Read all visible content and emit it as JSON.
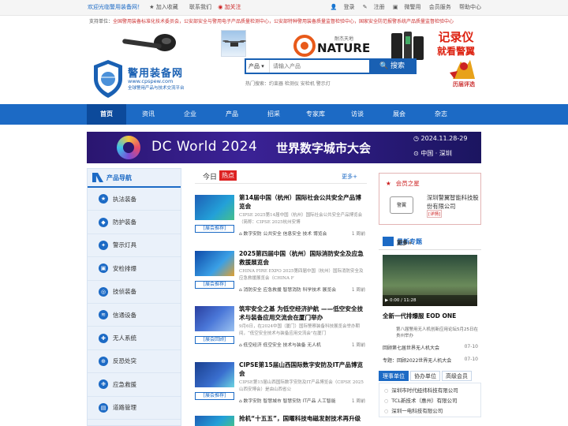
{
  "topbar": {
    "welcome": "欢迎光临警用装备网！",
    "add_favorite": "加入收藏",
    "contact": "联系我们",
    "follow": "加关注",
    "login": "登录",
    "register": "注册",
    "weibo": "微警用",
    "member_service": "会员服务",
    "help": "帮助中心"
  },
  "sponsor": {
    "label": "支持单位：",
    "text": "全国警用装备标准化技术委员会，公安部安全与警用电子产品质量检测中心，公安部特种警用装备质量监督检验中心，国家安全防范报警系统产品质量监督检验中心"
  },
  "ads": {
    "nature_brand": "NATURE",
    "nature_sub": "耐杰天地",
    "recorder_line1": "记录仪",
    "recorder_line2": "就看警翼"
  },
  "logo": {
    "title": "警用装备网",
    "url": "www.cpspew.com",
    "slogan": "全球警用产品与技术交流平台"
  },
  "search": {
    "category": "产品",
    "placeholder": "请输入产品",
    "button": "搜索",
    "hot_keywords": "热门搜索：约束器 检测仪 安检机 警示灯"
  },
  "award_label": "历届评选",
  "nav": [
    "首页",
    "资讯",
    "企业",
    "产品",
    "招采",
    "专家库",
    "访谈",
    "展会",
    "杂志"
  ],
  "banner": {
    "title_en": "DC World",
    "year": "2024",
    "title_cn": "世界数字城市大会",
    "date": "2024.11.28-29",
    "location": "中国 · 深圳"
  },
  "sidebar": {
    "title": "产品导航",
    "items": [
      "执法装备",
      "防护装备",
      "警示灯具",
      "安检排爆",
      "技侦装备",
      "信通设备",
      "无人系统",
      "反恐处突",
      "应急救援",
      "道路管理"
    ]
  },
  "main": {
    "today": "今日",
    "hot": "热点",
    "more": "更多+",
    "news": [
      {
        "title": "第14届中国（杭州）国际社会公共安全产品博览会",
        "desc": "CIPSE 2025第14届中国（杭州）国际社会公共安全产品博览会（简称：CIPSE 2025杭州安博",
        "tag": "[展会推荐]",
        "keywords": "数字安防 公共安全 信息安全 技术 博览会",
        "time": "1 周前"
      },
      {
        "title": "2025第四届中国（杭州）国际消防安全及应急救援展览会",
        "desc": "CHINA FIRE EXPO 2025第四届中国（杭州）国际消防安全及应急救援展览会（CHINA F",
        "tag": "[展会推荐]",
        "keywords": "消防安全 应急救援 智慧消防 科学技术 展览会",
        "time": "1 周前"
      },
      {
        "title": "筑牢安全之基 为低空经济护航 ——低空安全技术与装备应用交流会在厦门举办",
        "desc": "9月6日，在2024中国（厦门）国际警察装备科技展览会举办期间，“低空安全技术与装备应用交流会”在厦门",
        "tag": "[展会回顾]",
        "keywords": "低空经济 低空安全 技术与装备 无人机",
        "time": "1 周前"
      },
      {
        "title": "CIPSE第15届山西国际数字安防及IT产品博览会",
        "desc": "CIPSE第15届山西国际数字安防及IT产品博览会（CIPSE 2025山西安博会）是由山西省公",
        "tag": "[展会推荐]",
        "keywords": "数字安防 智慧城市 智慧安防 IT产品 人工智能",
        "time": "1 周前"
      },
      {
        "title": "抢机“十五五”，国曜科技电磁发射技术再升级",
        "desc": "",
        "tag": "",
        "keywords": "",
        "time": ""
      }
    ]
  },
  "member": {
    "title": "会员之星",
    "logo_text": "警翼",
    "name": "深圳警翼智能科技股份有限公司",
    "detail": "[详情]"
  },
  "topic": {
    "title": "最新专题",
    "more": "更多+",
    "video_time": "0:00 / 11:28",
    "video_title": "全新一代排爆服 EOD ONE",
    "video_desc": "第八届警用无人机创新应用论坛5月25日在贵州举办",
    "links": [
      {
        "text": "回顾第七届世界无人机大会",
        "time": "07-10"
      },
      {
        "text": "专题：回顾2022世界无人机大会",
        "time": "07-10"
      }
    ]
  },
  "units": {
    "tabs": [
      "理事单位",
      "协办单位",
      "高级会员"
    ],
    "items": [
      "深圳市时代经纬科技有限公司",
      "TCL新技术（惠州）有限公司",
      "深圳一电科技有限公司"
    ]
  },
  "colors": {
    "brand": "#1c6ac5",
    "accent_red": "#d22222"
  }
}
